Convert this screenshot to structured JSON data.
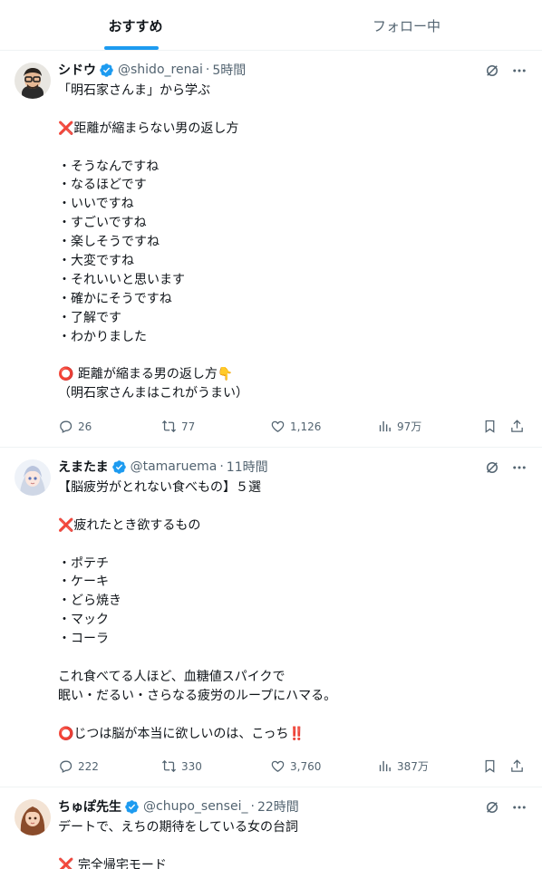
{
  "tabs": [
    {
      "label": "おすすめ",
      "active": true
    },
    {
      "label": "フォロー中",
      "active": false
    }
  ],
  "colors": {
    "accent": "#1d9bf0",
    "muted": "#536471",
    "text": "#0f1419",
    "cross": "#e0245e"
  },
  "tweets": [
    {
      "name": "シドウ",
      "handle": "@shido_renai",
      "dot": "·",
      "time": "5時間",
      "verified": true,
      "lines": [
        "「明石家さんま」から学ぶ",
        "",
        "❌距離が縮まらない男の返し方",
        "",
        "・そうなんですね",
        "・なるほどです",
        "・いいですね",
        "・すごいですね",
        "・楽しそうですね",
        "・大変ですね",
        "・それいいと思います",
        "・確かにそうですね",
        "・了解です",
        "・わかりました",
        "",
        "⭕ 距離が縮まる男の返し方👇",
        "（明石家さんまはこれがうまい）"
      ],
      "stats": {
        "replies": "26",
        "retweets": "77",
        "likes": "1,126",
        "views": "97万"
      }
    },
    {
      "name": "えまたま",
      "handle": "@tamaruema",
      "dot": "·",
      "time": "11時間",
      "verified": true,
      "lines": [
        "【脳疲労がとれない食べもの】５選",
        "",
        "❌疲れたとき欲するもの",
        "",
        "・ポテチ",
        "・ケーキ",
        "・どら焼き",
        "・マック",
        "・コーラ",
        "",
        "これ食べてる人ほど、血糖値スパイクで",
        "眠い・だるい・さらなる疲労のループにハマる。",
        "",
        "⭕じつは脳が本当に欲しいのは、こっち‼️"
      ],
      "stats": {
        "replies": "222",
        "retweets": "330",
        "likes": "3,760",
        "views": "387万"
      }
    },
    {
      "name": "ちゅぽ先生",
      "handle": "@chupo_sensei_",
      "dot": "·",
      "time": "22時間",
      "verified": true,
      "lines": [
        "デートで、えちの期待をしている女の台詞",
        "",
        "❌ 完全帰宅モード"
      ],
      "stats": {
        "replies": "",
        "retweets": "",
        "likes": "",
        "views": ""
      }
    }
  ]
}
